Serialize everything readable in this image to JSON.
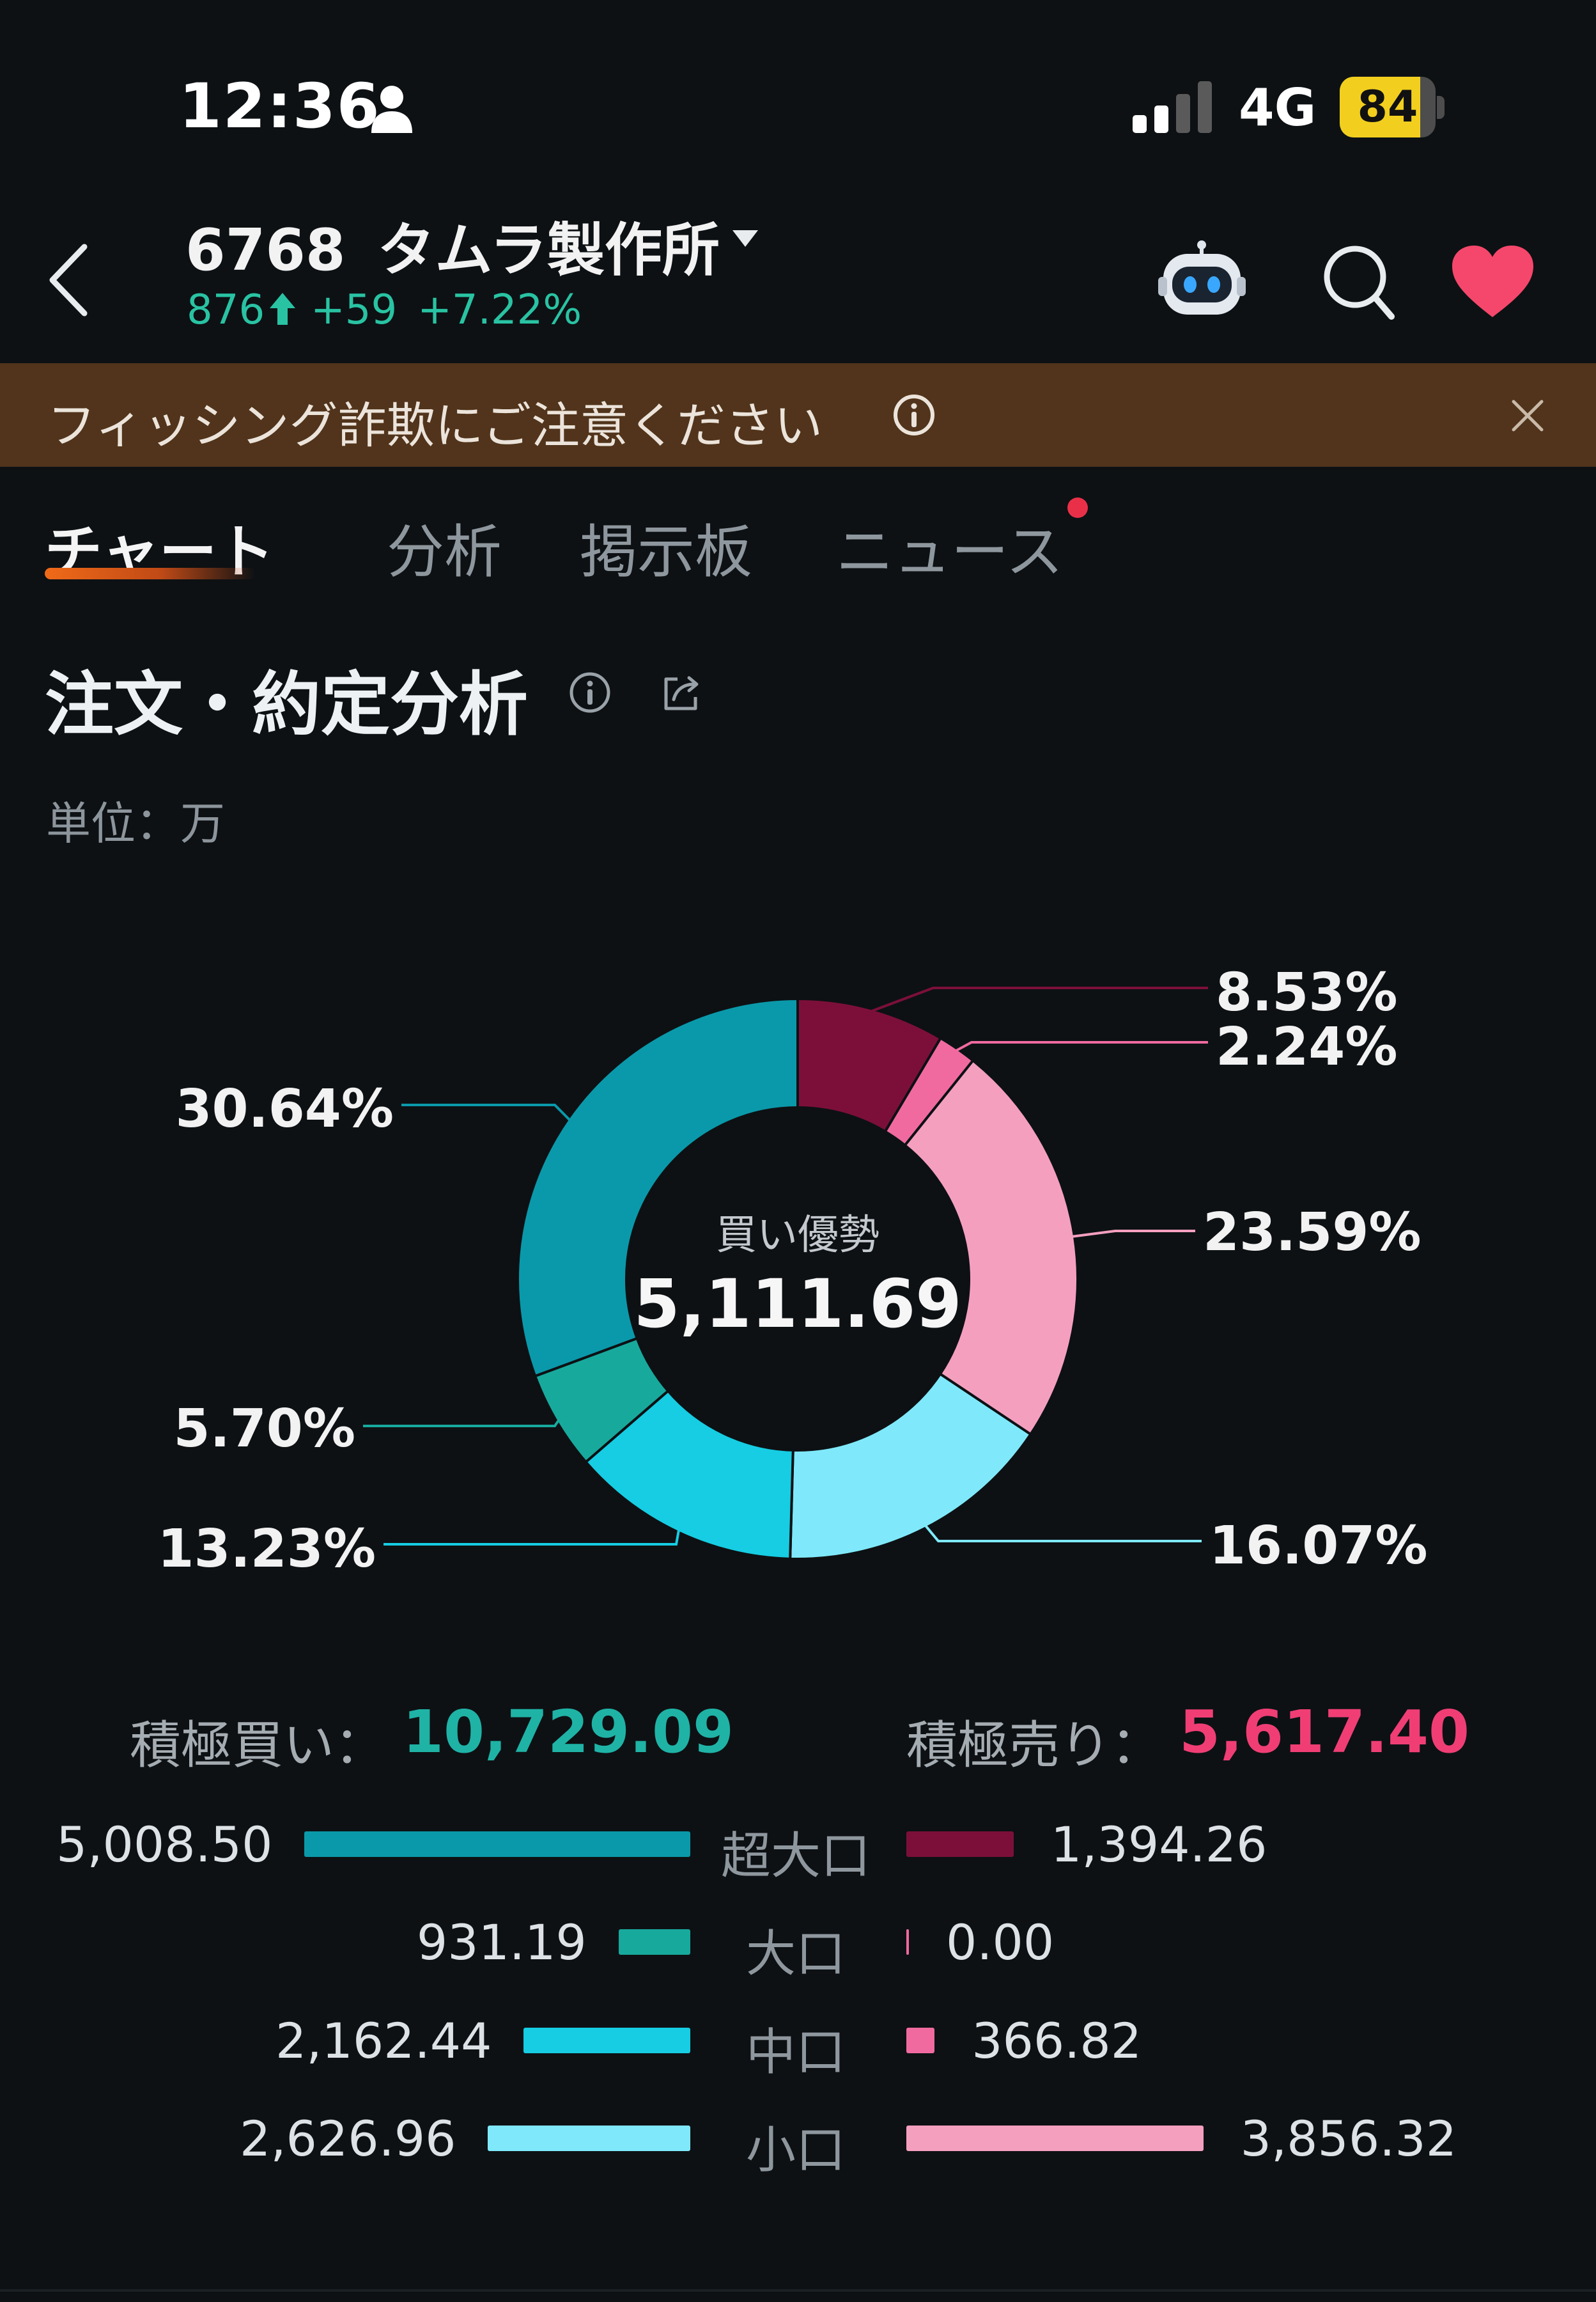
{
  "status_bar": {
    "time": "12:36",
    "network": "4G",
    "battery": "84"
  },
  "header": {
    "code": "6768",
    "name": "タムラ製作所",
    "price": "876",
    "change": "+59",
    "change_pct": "+7.22%"
  },
  "banner": {
    "text": "フィッシング詐欺にご注意ください"
  },
  "tabs": [
    {
      "label": "チャート",
      "active": true
    },
    {
      "label": "分析",
      "active": false
    },
    {
      "label": "掲示板",
      "active": false
    },
    {
      "label": "ニュース",
      "active": false,
      "notification": true
    }
  ],
  "section": {
    "title": "注文・約定分析",
    "unit": "単位：万"
  },
  "donut": {
    "center_label": "買い優勢",
    "center_value": "5,111.69",
    "slices": [
      {
        "label": "8.53%",
        "value": 8.53,
        "color": "#7c0f3a"
      },
      {
        "label": "2.24%",
        "value": 2.24,
        "color": "#f06aa0"
      },
      {
        "label": "23.59%",
        "value": 23.59,
        "color": "#f59fbf"
      },
      {
        "label": "16.07%",
        "value": 16.07,
        "color": "#7fe9fb"
      },
      {
        "label": "13.23%",
        "value": 13.23,
        "color": "#16cde3"
      },
      {
        "label": "5.70%",
        "value": 5.7,
        "color": "#18a99d"
      },
      {
        "label": "30.64%",
        "value": 30.64,
        "color": "#0a99aa"
      }
    ]
  },
  "totals": {
    "buy_label": "積極買い：",
    "buy_value": "10,729.09",
    "sell_label": "積極売り：",
    "sell_value": "5,617.40"
  },
  "flows": [
    {
      "category": "超大口",
      "buy": "5,008.50",
      "buy_num": 5008.5,
      "sell": "1,394.26",
      "sell_num": 1394.26,
      "buy_color": "#0a99aa",
      "sell_color": "#7c0f3a"
    },
    {
      "category": "大口",
      "buy": "931.19",
      "buy_num": 931.19,
      "sell": "0.00",
      "sell_num": 0.0,
      "buy_color": "#18a99d",
      "sell_color": "#f06aa0"
    },
    {
      "category": "中口",
      "buy": "2,162.44",
      "buy_num": 2162.44,
      "sell": "366.82",
      "sell_num": 366.82,
      "buy_color": "#16cde3",
      "sell_color": "#f06aa0"
    },
    {
      "category": "小口",
      "buy": "2,626.96",
      "buy_num": 2626.96,
      "sell": "3,856.32",
      "sell_num": 3856.32,
      "buy_color": "#7fe9fb",
      "sell_color": "#f59fbf"
    }
  ]
}
